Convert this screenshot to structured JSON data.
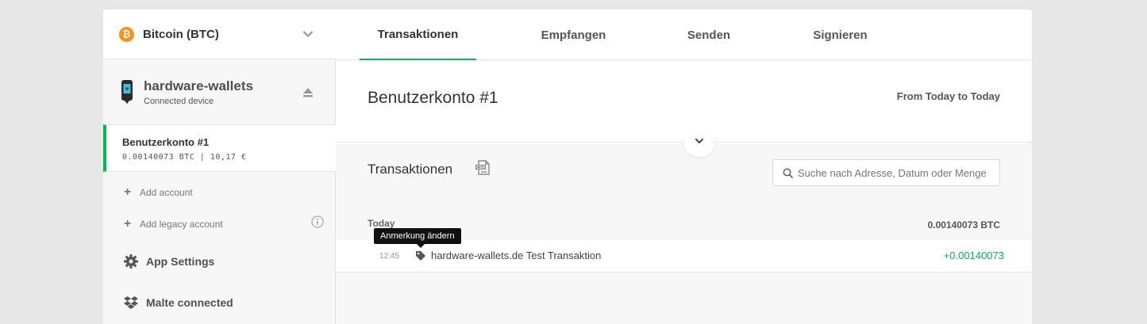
{
  "sidebar": {
    "coin": {
      "icon": "bitcoin-icon",
      "symbol": "₿",
      "name": "Bitcoin (BTC)"
    },
    "device": {
      "name": "hardware-wallets",
      "status": "Connected device"
    },
    "active_account": {
      "name": "Benutzerkonto #1",
      "balance": "0.00140073 BTC | 10,17 €"
    },
    "add_account": "Add account",
    "add_legacy_account": "Add legacy account",
    "app_settings": "App Settings",
    "dropbox_status": "Malte connected"
  },
  "tabs": [
    {
      "label": "Transaktionen",
      "active": true
    },
    {
      "label": "Empfangen",
      "active": false
    },
    {
      "label": "Senden",
      "active": false
    },
    {
      "label": "Signieren",
      "active": false
    }
  ],
  "account_header": {
    "title": "Benutzerkonto #1",
    "date_range": "From Today to Today"
  },
  "transactions": {
    "title": "Transaktionen",
    "search_placeholder": "Suche nach Adresse, Datum oder Menge",
    "day": {
      "label": "Today",
      "total": "0.00140073 BTC"
    },
    "tooltip": "Anmerkung ändern",
    "rows": [
      {
        "time": "12:45",
        "description": "hardware-wallets.de Test Transaktion",
        "amount": "+0.00140073"
      }
    ]
  },
  "colors": {
    "accent": "#01b757",
    "bitcoin": "#f7931a",
    "background": "#e7e7e7"
  }
}
